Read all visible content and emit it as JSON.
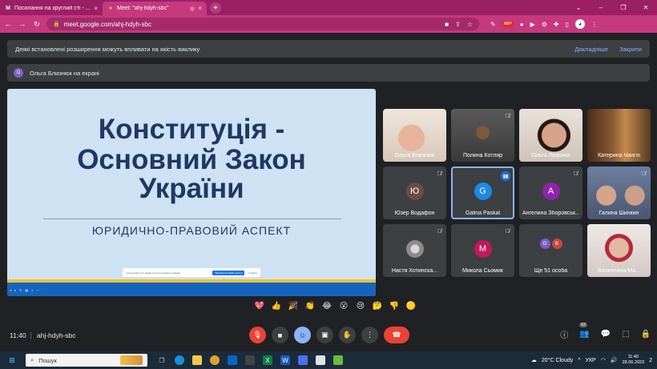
{
  "browser": {
    "tabs": [
      {
        "title": "Посилання на круглий сті - ...",
        "favicon": "M",
        "active": false
      },
      {
        "title": "Meet: \"ahj-hdyh-sbc\"",
        "favicon": "●",
        "active": true
      }
    ],
    "url": "meet.google.com/ahj-hdyh-sbc",
    "ext_abp": "ABP"
  },
  "banner": {
    "text": "Деякі встановлені розширення можуть впливати на якість виклику",
    "learn_more": "Докладніше",
    "close": "Закрити"
  },
  "presenter": {
    "initial": "О",
    "text": "Ольга Близнюк на екрані"
  },
  "slide": {
    "line1": "Конституція -",
    "line2": "Основний Закон",
    "line3": "України",
    "subtitle": "ЮРИДИЧНО-ПРАВОВИЙ АСПЕКТ",
    "sharebar_text": "meet.google.com надає доступ до вашого екрана.",
    "sharebar_stop": "Припинити обмін доступ",
    "sharebar_hide": "Сховати"
  },
  "tiles": [
    {
      "name": "Ольга Близнюк",
      "type": "camera",
      "muted": false
    },
    {
      "name": "Полина Котляр",
      "type": "camera",
      "muted": true
    },
    {
      "name": "Ольга Лісконог",
      "type": "camera",
      "muted": true
    },
    {
      "name": "Катерина Чанглі",
      "type": "camera",
      "muted": false
    },
    {
      "name": "Юзер Водафон",
      "type": "avatar",
      "initial": "Ю",
      "color": "#6d4c41",
      "muted": true
    },
    {
      "name": "Galina Paskal",
      "type": "avatar",
      "initial": "G",
      "color": "#1e88e5",
      "speaking": true
    },
    {
      "name": "Ангелина Зборовськ...",
      "type": "avatar",
      "initial": "А",
      "color": "#8e24aa",
      "muted": true
    },
    {
      "name": "Галина Шинкин",
      "type": "camera",
      "muted": true
    },
    {
      "name": "Настя Хотинска...",
      "type": "avatar-photo",
      "muted": true
    },
    {
      "name": "Микола Сьомик",
      "type": "avatar",
      "initial": "М",
      "color": "#c2185b",
      "muted": true
    },
    {
      "name": "Ще 51 особа",
      "type": "more",
      "initials": [
        "О",
        "В"
      ]
    },
    {
      "name": "Валентина Ма...",
      "type": "camera",
      "muted": true
    }
  ],
  "reactions": [
    "💖",
    "👍",
    "🎉",
    "👏",
    "😂",
    "😮",
    "😢",
    "🤔",
    "👎",
    "🟡"
  ],
  "bottom": {
    "time": "11:40",
    "code": "ahj-hdyh-sbc",
    "participants_count": "63"
  },
  "taskbar": {
    "search": "Пошук",
    "weather": "20°C  Cloudy",
    "lang": "УКР",
    "time": "11:40",
    "date": "28.06.2023",
    "notif": "2"
  }
}
